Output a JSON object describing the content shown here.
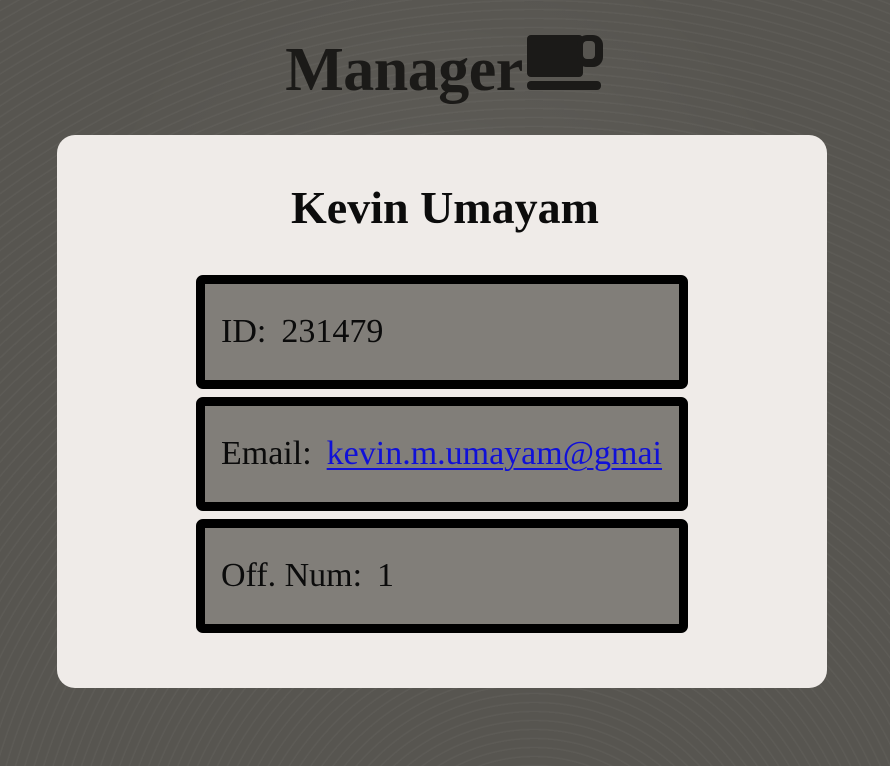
{
  "header": {
    "title": "Manager",
    "icon": "coffee-mug-icon"
  },
  "profile": {
    "name": "Kevin Umayam",
    "fields": {
      "id": {
        "label": "ID:",
        "value": "231479"
      },
      "email": {
        "label": "Email:",
        "value": "kevin.m.umayam@gmai"
      },
      "office": {
        "label": "Off. Num:",
        "value": "1"
      }
    }
  },
  "colors": {
    "background": "#575550",
    "card": "#efebe8",
    "field_fill": "#817e79",
    "field_border": "#000000",
    "link": "#1010d8"
  }
}
